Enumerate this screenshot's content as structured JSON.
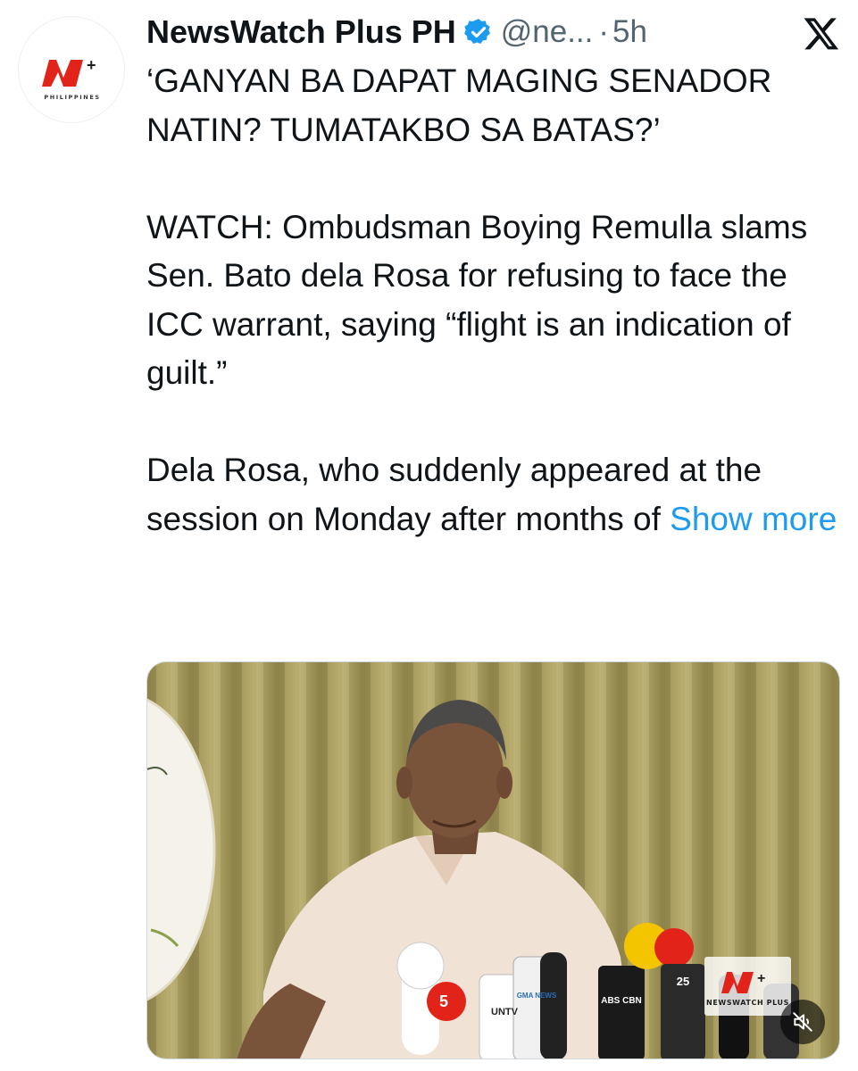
{
  "tweet": {
    "author_name": "NewsWatch Plus PH",
    "handle": "@ne...",
    "separator": "·",
    "time": "5h",
    "avatar_logo": {
      "mark": "NW+",
      "subtitle": "PHILIPPINES"
    },
    "paragraphs": [
      "‘GANYAN BA DAPAT MAGING SENADOR NATIN? TUMATAKBO SA BATAS?’",
      "WATCH: Ombudsman Boying Remulla slams Sen. Bato dela Rosa for refusing to face the ICC warrant, saying “flight is an indication of guilt.”"
    ],
    "last_paragraph": "Dela Rosa, who suddenly appeared at the session on Monday after months of",
    "show_more": "Show more"
  },
  "media": {
    "type": "video",
    "watermark": {
      "mark": "NW+",
      "subtitle": "NEWSWATCH PLUS"
    },
    "mic_labels": [
      "5",
      "UNTV",
      "GMA NEWS",
      "ABS CBN",
      "25"
    ],
    "mute_icon": "speaker-muted-icon"
  },
  "colors": {
    "link": "#1d9bf0",
    "text": "#0f1419",
    "secondary": "#536471",
    "verified": "#1d9bf0",
    "brand_red": "#e2231a"
  }
}
